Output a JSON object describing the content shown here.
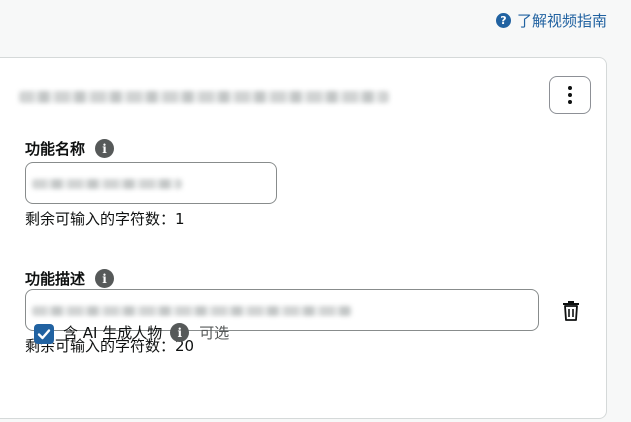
{
  "guide_link": {
    "label": "了解视频指南"
  },
  "feature_card": {
    "name_field": {
      "label": "功能名称",
      "remaining_hint": "剩余可输入的字符数：1"
    },
    "description_field": {
      "label": "功能描述",
      "remaining_hint": "剩余可输入的字符数：20"
    },
    "ai_checkbox": {
      "label": "含 AI 生成人物",
      "checked": true,
      "optional_text": "可选"
    }
  },
  "icons": {
    "help": "question-circle-icon",
    "menu": "more-vertical-icon",
    "info": "info-icon",
    "delete": "trash-icon",
    "check": "checkmark-icon"
  },
  "colors": {
    "accent": "#2162a1",
    "border": "#888c8c",
    "info_icon": "#565959"
  }
}
